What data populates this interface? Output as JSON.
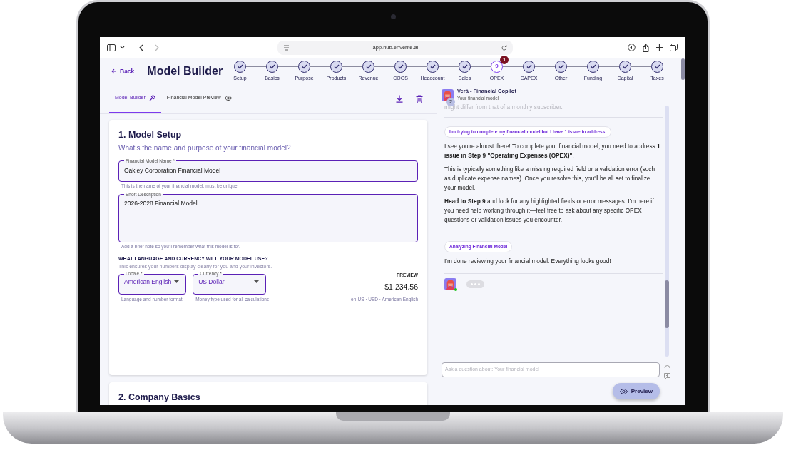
{
  "browser": {
    "url": "app.hub.enverite.ai"
  },
  "header": {
    "back": "Back",
    "title": "Model Builder"
  },
  "steps": [
    {
      "label": "Setup",
      "done": true
    },
    {
      "label": "Basics",
      "done": true
    },
    {
      "label": "Purpose",
      "done": true
    },
    {
      "label": "Products",
      "done": true
    },
    {
      "label": "Revenue",
      "done": true
    },
    {
      "label": "COGS",
      "done": true
    },
    {
      "label": "Headcount",
      "done": true
    },
    {
      "label": "Sales",
      "done": true
    },
    {
      "label": "OPEX",
      "done": false,
      "number": "9",
      "badge": "1"
    },
    {
      "label": "CAPEX",
      "done": true
    },
    {
      "label": "Other",
      "done": true
    },
    {
      "label": "Funding",
      "done": true
    },
    {
      "label": "Capital",
      "done": true
    },
    {
      "label": "Taxes",
      "done": true
    }
  ],
  "tabs": [
    {
      "label": "Model Builder",
      "selected": true
    },
    {
      "label": "Financial Model Preview",
      "selected": false
    }
  ],
  "setup": {
    "title": "1. Model Setup",
    "subtitle": "What’s the name and purpose of your financial model?",
    "fields": [
      {
        "kind": "input",
        "label": "Financial Model Name *",
        "value": "Oakley Corporation Financial Model",
        "helper": "This is the name of your financial model, must be unique."
      },
      {
        "kind": "textarea",
        "label": "Short Description",
        "value": "2026-2028 Financial Model",
        "helper": "Add a brief note so you'll remember what this model is for."
      }
    ],
    "locale_heading": "WHAT LANGUAGE AND CURRENCY WILL YOUR MODEL USE?",
    "locale_subtitle": "This ensures your numbers display clearly for you and your investors.",
    "selects": [
      {
        "label": "Locale *",
        "value": "American English",
        "helper": "Language and number format"
      },
      {
        "label": "Currency *",
        "value": "US Dollar",
        "helper": "Money type used for all calculations"
      }
    ],
    "preview": {
      "label": "PREVIEW",
      "value": "$1,234.56",
      "detail": "en-US · USD · American English"
    }
  },
  "next_section": {
    "title": "2. Company Basics"
  },
  "chat": {
    "title": "Verá - Financial Copilot",
    "subtitle": "Your financial model",
    "badge": "2",
    "messages": [
      {
        "kind": "faded",
        "text": "might differ from that of a monthly subscriber."
      },
      {
        "kind": "exchange",
        "prompt": "I'm trying to complete my financial model but I have 1 issue to address.",
        "paragraphs": [
          "I see you're almost there! To complete your financial model, you need to address **1 issue in Step 9 \"Operating Expenses (OPEX)\"**.",
          "This is typically something like a missing required field or a validation error (such as duplicate expense names). Once you resolve this, you'll be all set to finalize your model.",
          "**Head to Step 9** and look for any highlighted fields or error messages. I'm here if you need help working through it—feel free to ask about any specific OPEX questions or validation issues you encounter."
        ]
      },
      {
        "kind": "exchange",
        "prompt": "Analyzing Financial Model",
        "paragraphs": [
          "I'm done reviewing your financial model. Everything looks good!"
        ]
      },
      {
        "kind": "typing",
        "online": true
      }
    ],
    "input_placeholder": "Ask a question about: Your financial model",
    "preview_button": "Preview"
  }
}
